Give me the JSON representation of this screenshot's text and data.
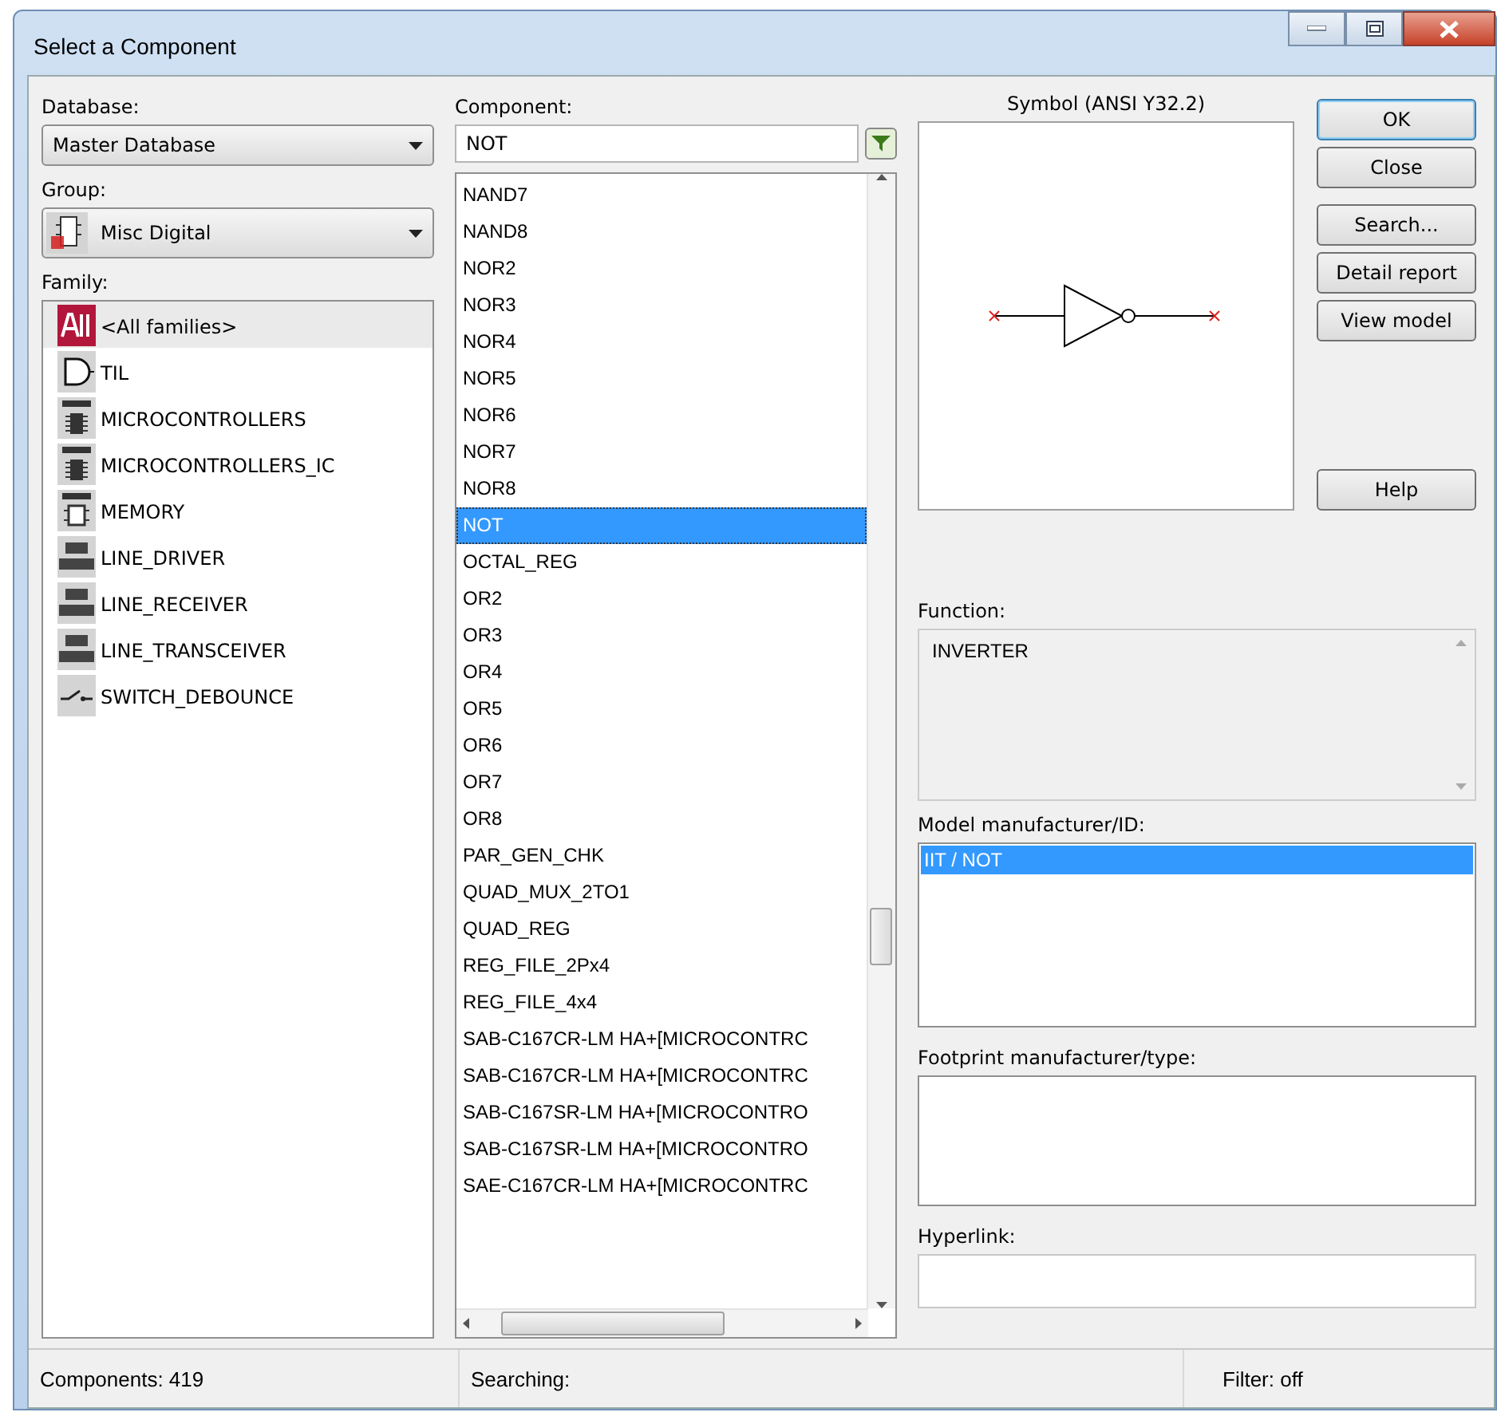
{
  "window": {
    "title": "Select a Component"
  },
  "database": {
    "label": "Database:",
    "value": "Master Database"
  },
  "group": {
    "label": "Group:",
    "value": "Misc Digital"
  },
  "family": {
    "label": "Family:",
    "items": [
      {
        "label": "<All families>",
        "kind": "all",
        "selected": true
      },
      {
        "label": "TIL",
        "kind": "gate",
        "selected": false
      },
      {
        "label": "MICROCONTROLLERS",
        "kind": "chip",
        "selected": false
      },
      {
        "label": "MICROCONTROLLERS_IC",
        "kind": "chip",
        "selected": false
      },
      {
        "label": "MEMORY",
        "kind": "memory",
        "selected": false
      },
      {
        "label": "LINE_DRIVER",
        "kind": "line",
        "selected": false
      },
      {
        "label": "LINE_RECEIVER",
        "kind": "line",
        "selected": false
      },
      {
        "label": "LINE_TRANSCEIVER",
        "kind": "line",
        "selected": false
      },
      {
        "label": "SWITCH_DEBOUNCE",
        "kind": "switch",
        "selected": false
      }
    ]
  },
  "component": {
    "label": "Component:",
    "value": "NOT",
    "items": [
      {
        "label": "NAND7",
        "selected": false
      },
      {
        "label": "NAND8",
        "selected": false
      },
      {
        "label": "NOR2",
        "selected": false
      },
      {
        "label": "NOR3",
        "selected": false
      },
      {
        "label": "NOR4",
        "selected": false
      },
      {
        "label": "NOR5",
        "selected": false
      },
      {
        "label": "NOR6",
        "selected": false
      },
      {
        "label": "NOR7",
        "selected": false
      },
      {
        "label": "NOR8",
        "selected": false
      },
      {
        "label": "NOT",
        "selected": true
      },
      {
        "label": "OCTAL_REG",
        "selected": false
      },
      {
        "label": "OR2",
        "selected": false
      },
      {
        "label": "OR3",
        "selected": false
      },
      {
        "label": "OR4",
        "selected": false
      },
      {
        "label": "OR5",
        "selected": false
      },
      {
        "label": "OR6",
        "selected": false
      },
      {
        "label": "OR7",
        "selected": false
      },
      {
        "label": "OR8",
        "selected": false
      },
      {
        "label": "PAR_GEN_CHK",
        "selected": false
      },
      {
        "label": "QUAD_MUX_2TO1",
        "selected": false
      },
      {
        "label": "QUAD_REG",
        "selected": false
      },
      {
        "label": "REG_FILE_2Px4",
        "selected": false
      },
      {
        "label": "REG_FILE_4x4",
        "selected": false
      },
      {
        "label": "SAB-C167CR-LM HA+[MICROCONTRC",
        "selected": false
      },
      {
        "label": "SAB-C167CR-LM HA+[MICROCONTRC",
        "selected": false
      },
      {
        "label": "SAB-C167SR-LM HA+[MICROCONTRO",
        "selected": false
      },
      {
        "label": "SAB-C167SR-LM HA+[MICROCONTRO",
        "selected": false
      },
      {
        "label": "SAE-C167CR-LM HA+[MICROCONTRC",
        "selected": false
      }
    ]
  },
  "symbol": {
    "title": "Symbol (ANSI Y32.2)"
  },
  "buttons": [
    {
      "label": "OK",
      "default": true
    },
    {
      "label": "Close",
      "default": false
    },
    {
      "label": "Search...",
      "default": false
    },
    {
      "label": "Detail report",
      "default": false
    },
    {
      "label": "View model",
      "default": false
    },
    {
      "label": "Help",
      "default": false
    }
  ],
  "function": {
    "label": "Function:",
    "value": "INVERTER"
  },
  "model": {
    "label": "Model manufacturer/ID:",
    "items": [
      {
        "label": "IIT / NOT",
        "selected": true
      }
    ]
  },
  "footprint": {
    "label": "Footprint manufacturer/type:"
  },
  "hyperlink": {
    "label": "Hyperlink:"
  },
  "status_bar": [
    "Components: 419",
    "Searching:",
    "Filter: off"
  ]
}
